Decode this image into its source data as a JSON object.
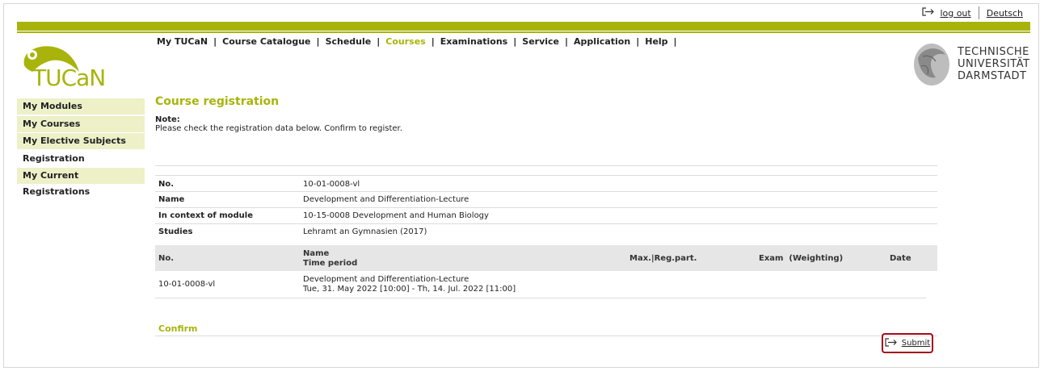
{
  "header": {
    "logout_label": "log out",
    "language_label": "Deutsch",
    "logo_text": "TUCaN",
    "university_lines": [
      "TECHNISCHE",
      "UNIVERSITÄT",
      "DARMSTADT"
    ],
    "accent_color": "#a8b40b"
  },
  "nav": {
    "items": [
      "My TUCaN",
      "Course Catalogue",
      "Schedule",
      "Courses",
      "Examinations",
      "Service",
      "Application",
      "Help"
    ],
    "active": "Courses"
  },
  "sidebar": {
    "items": [
      "My Modules",
      "My Courses",
      "My Elective Subjects",
      "Registration",
      "My Current Registrations"
    ]
  },
  "main": {
    "title": "Course registration",
    "note_label": "Note:",
    "note_text": "Please check the registration data below. Confirm to register.",
    "details": [
      {
        "label": "No.",
        "value": "10-01-0008-vl"
      },
      {
        "label": "Name",
        "value": "Development and Differentiation-Lecture"
      },
      {
        "label": "In context of module",
        "value": "10-15-0008 Development and Human Biology"
      },
      {
        "label": "Studies",
        "value": "Lehramt an Gymnasien (2017)"
      }
    ],
    "table": {
      "headers": {
        "no": "No.",
        "name": "Name",
        "time_period": "Time period",
        "max_reg": "Max.|Reg.part.",
        "exam": "Exam  (Weighting)",
        "date": "Date"
      },
      "row": {
        "no": "10-01-0008-vl",
        "name": "Development and Differentiation-Lecture",
        "time_period": "Tue, 31. May 2022 [10:00] - Th, 14. Jul. 2022 [11:00]"
      }
    },
    "confirm_label": "Confirm",
    "submit_label": "Submit"
  }
}
